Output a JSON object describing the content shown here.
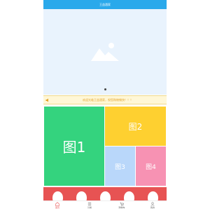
{
  "header": {
    "title": "王益酒家"
  },
  "notice": {
    "text": "欢迎光临王益酒家，祝您购物愉快！！！"
  },
  "tiles": [
    "图1",
    "图2",
    "图3",
    "图4"
  ],
  "tabbar": {
    "items": [
      "首页",
      "分类",
      "购物车",
      "我的"
    ],
    "active": 0
  },
  "colors": {
    "header": "#2aa9eb",
    "accent": "#e75353",
    "tile1": "#34d37e",
    "tile2": "#fed030",
    "tile3": "#b9d7fa",
    "tile4": "#f792b3",
    "notice": "#e3a32b"
  }
}
